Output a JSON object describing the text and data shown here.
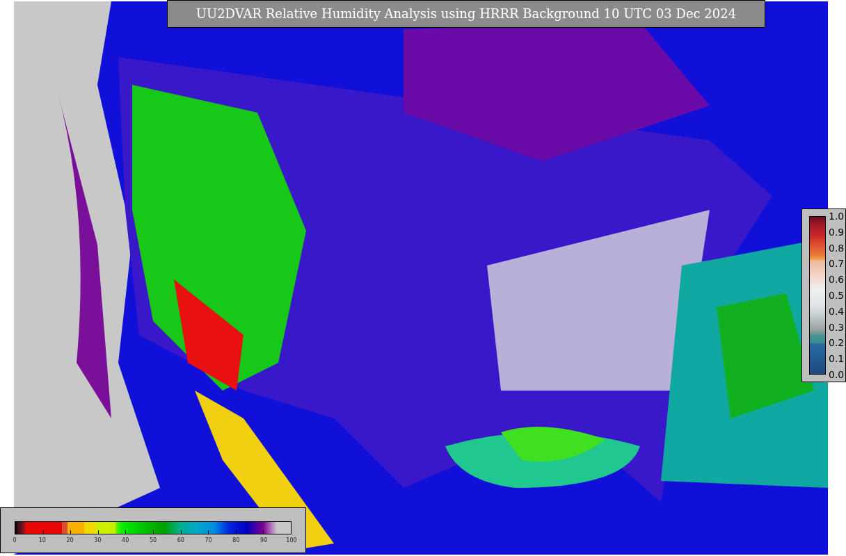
{
  "title": "UU2DVAR Relative Humidity Analysis using HRRR Background 10 UTC 03 Dec 2024",
  "humidity_colorbar": {
    "ticks": [
      "0",
      "10",
      "20",
      "30",
      "40",
      "50",
      "60",
      "70",
      "80",
      "90",
      "100"
    ]
  },
  "ratio_colorbar": {
    "ticks": [
      "1.0",
      "0.9",
      "0.8",
      "0.7",
      "0.6",
      "0.5",
      "0.4",
      "0.3",
      "0.2",
      "0.1",
      "0.0"
    ]
  }
}
